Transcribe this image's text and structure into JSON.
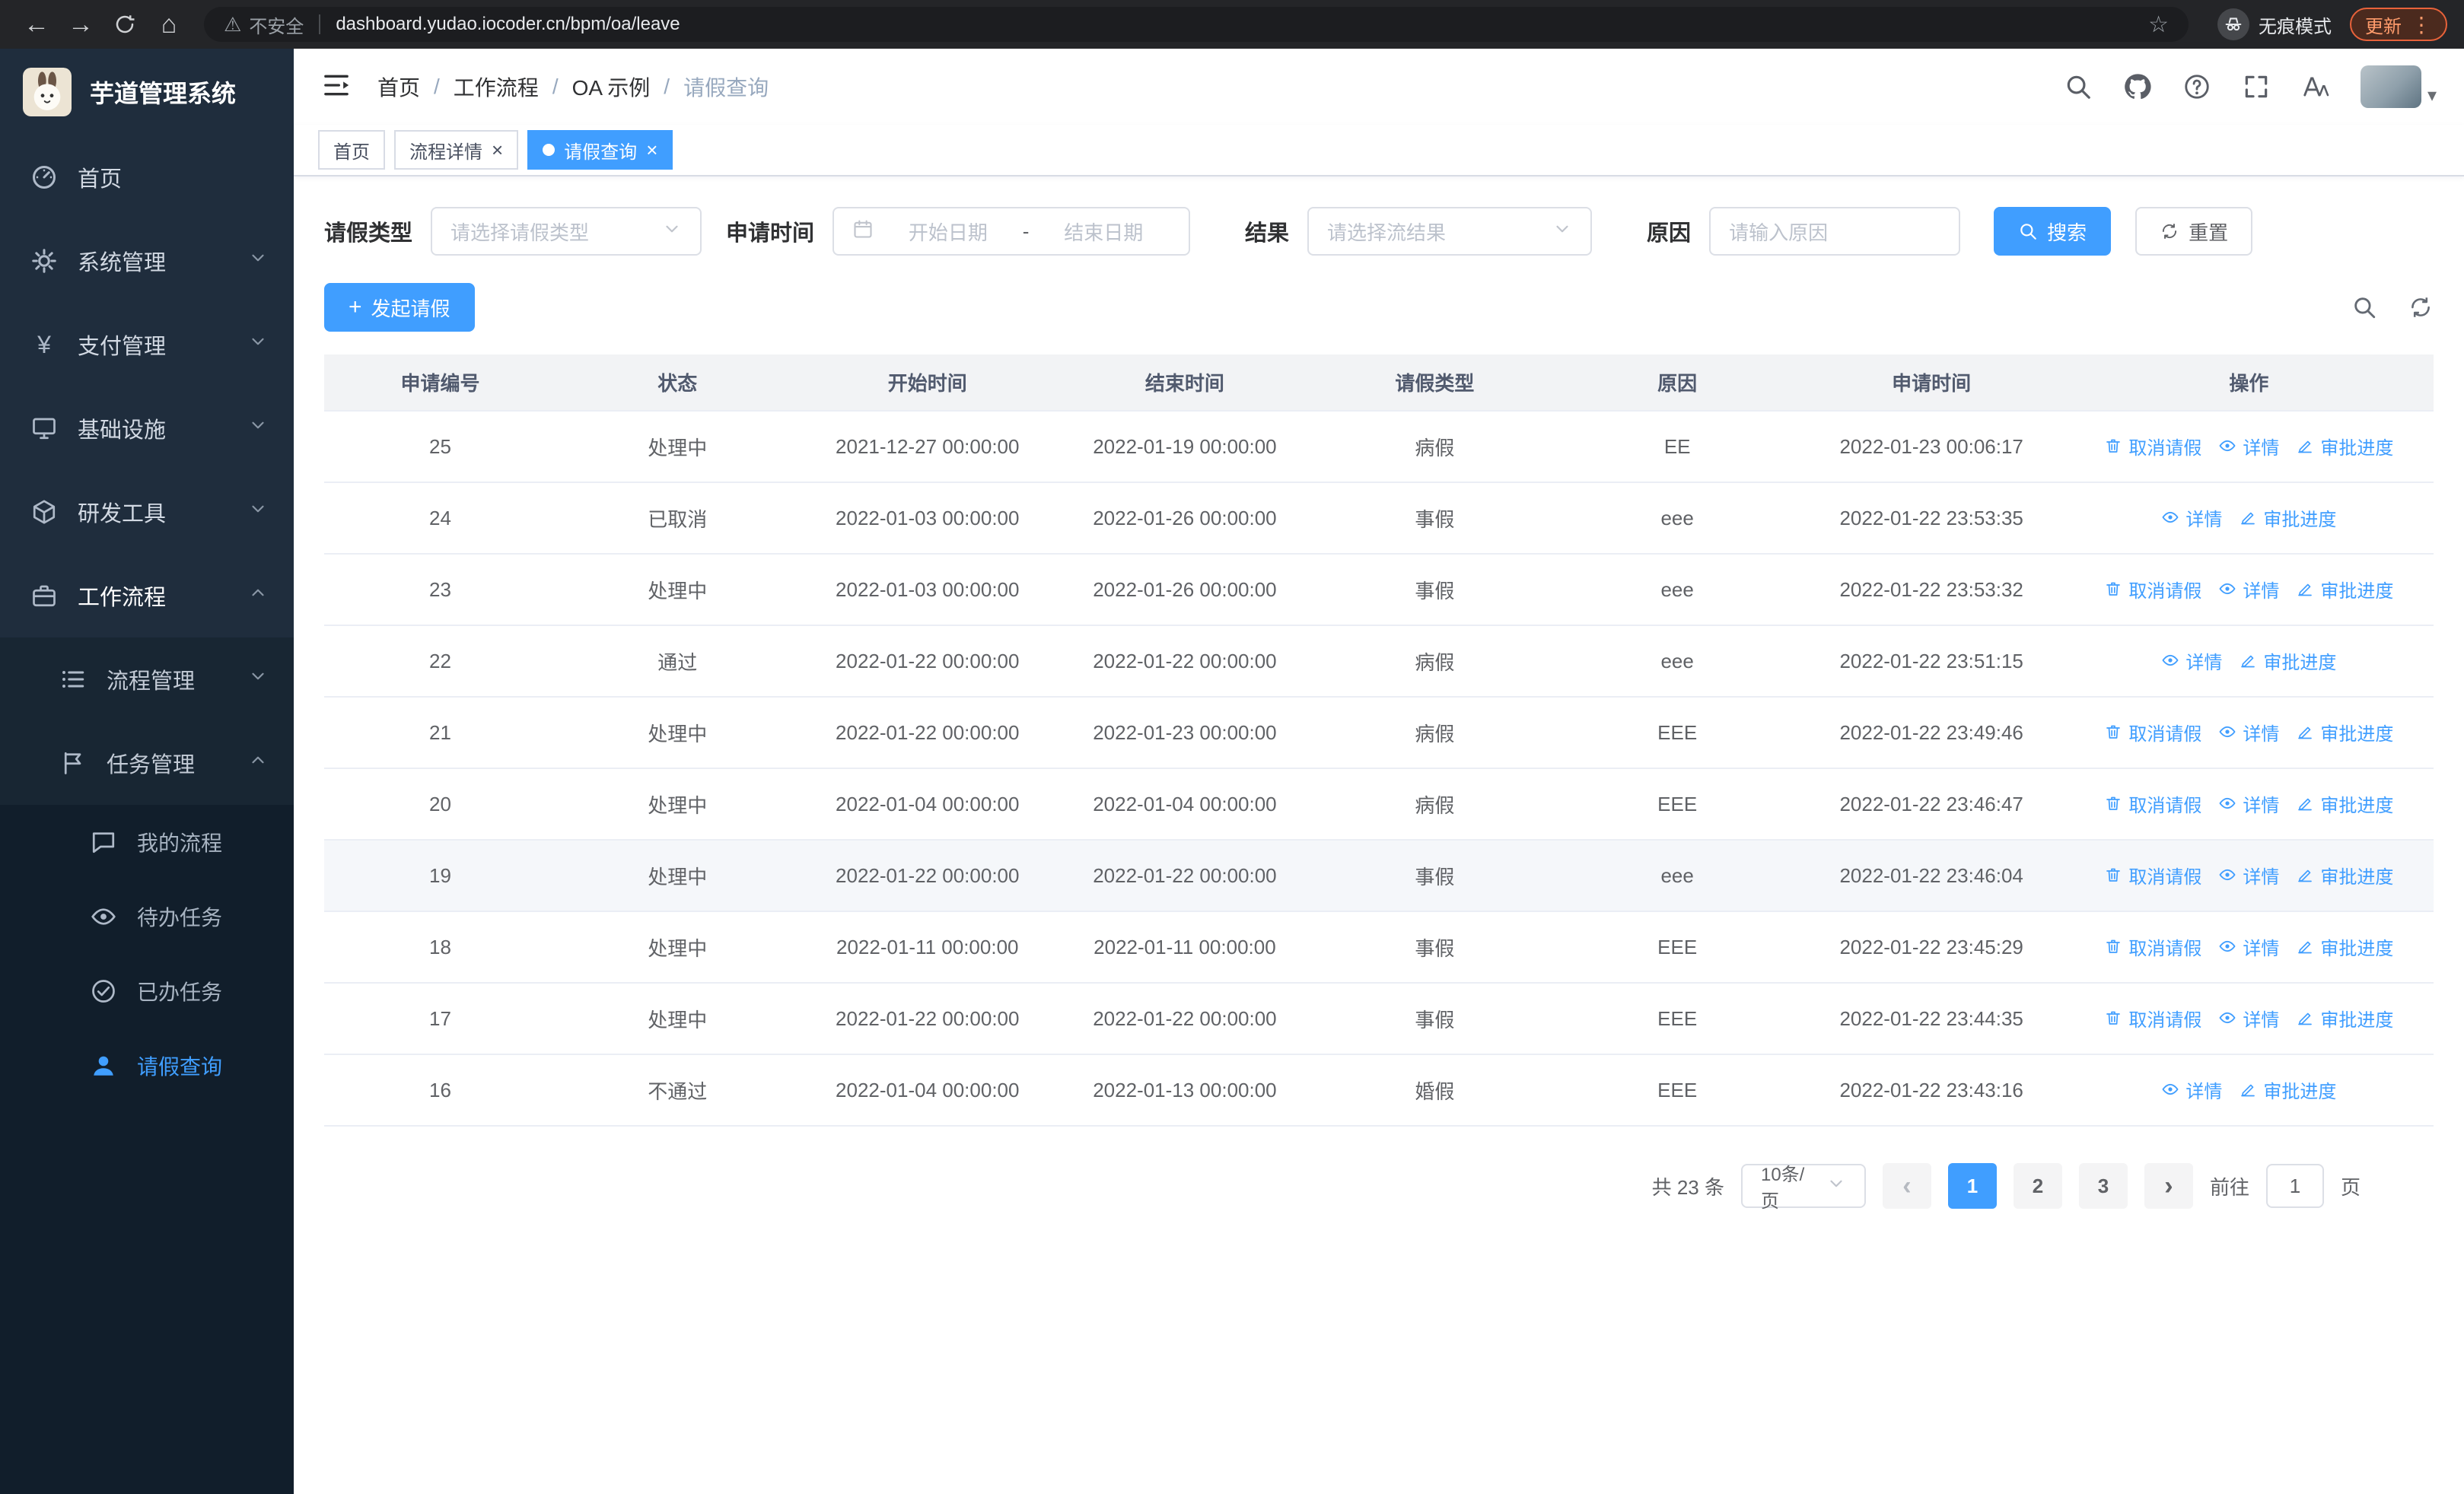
{
  "browser": {
    "security_label": "不安全",
    "url": "dashboard.yudao.iocoder.cn/bpm/oa/leave",
    "incognito_label": "无痕模式",
    "update_label": "更新"
  },
  "icons": {
    "back": "←",
    "forward": "→",
    "home": "⌂",
    "warning": "⚠",
    "star": "☆",
    "kebab": "⋮",
    "caret": "▾",
    "prev": "‹",
    "next": "›",
    "close": "×",
    "plus": "+",
    "yen": "¥"
  },
  "sidebar": {
    "logo_title": "芋道管理系统",
    "items": [
      {
        "label": "首页"
      },
      {
        "label": "系统管理"
      },
      {
        "label": "支付管理"
      },
      {
        "label": "基础设施"
      },
      {
        "label": "研发工具"
      },
      {
        "label": "工作流程"
      }
    ],
    "submenu": [
      {
        "label": "流程管理"
      },
      {
        "label": "任务管理"
      }
    ],
    "deep_items": [
      {
        "label": "我的流程"
      },
      {
        "label": "待办任务"
      },
      {
        "label": "已办任务"
      },
      {
        "label": "请假查询"
      }
    ]
  },
  "header": {
    "separator": "/",
    "breadcrumbs": [
      "首页",
      "工作流程",
      "OA 示例",
      "请假查询"
    ]
  },
  "tabs": [
    {
      "label": "首页"
    },
    {
      "label": "流程详情"
    },
    {
      "label": "请假查询"
    }
  ],
  "filters": {
    "leave_type_label": "请假类型",
    "leave_type_placeholder": "请选择请假类型",
    "apply_time_label": "申请时间",
    "start_date_placeholder": "开始日期",
    "range_separator": "-",
    "end_date_placeholder": "结束日期",
    "result_label": "结果",
    "result_placeholder": "请选择流结果",
    "reason_label": "原因",
    "reason_placeholder": "请输入原因",
    "search_button": "搜索",
    "reset_button": "重置"
  },
  "toolbar": {
    "create_button": "发起请假"
  },
  "table": {
    "columns": [
      "申请编号",
      "状态",
      "开始时间",
      "结束时间",
      "请假类型",
      "原因",
      "申请时间",
      "操作"
    ],
    "actions": {
      "cancel": "取消请假",
      "detail": "详情",
      "progress": "审批进度"
    },
    "rows": [
      {
        "id": "25",
        "status": "处理中",
        "start": "2021-12-27 00:00:00",
        "end": "2022-01-19 00:00:00",
        "type": "病假",
        "reason": "EE",
        "applied": "2022-01-23 00:06:17",
        "cancelable": true,
        "hover": false
      },
      {
        "id": "24",
        "status": "已取消",
        "start": "2022-01-03 00:00:00",
        "end": "2022-01-26 00:00:00",
        "type": "事假",
        "reason": "eee",
        "applied": "2022-01-22 23:53:35",
        "cancelable": false,
        "hover": false
      },
      {
        "id": "23",
        "status": "处理中",
        "start": "2022-01-03 00:00:00",
        "end": "2022-01-26 00:00:00",
        "type": "事假",
        "reason": "eee",
        "applied": "2022-01-22 23:53:32",
        "cancelable": true,
        "hover": false
      },
      {
        "id": "22",
        "status": "通过",
        "start": "2022-01-22 00:00:00",
        "end": "2022-01-22 00:00:00",
        "type": "病假",
        "reason": "eee",
        "applied": "2022-01-22 23:51:15",
        "cancelable": false,
        "hover": false
      },
      {
        "id": "21",
        "status": "处理中",
        "start": "2022-01-22 00:00:00",
        "end": "2022-01-23 00:00:00",
        "type": "病假",
        "reason": "EEE",
        "applied": "2022-01-22 23:49:46",
        "cancelable": true,
        "hover": false
      },
      {
        "id": "20",
        "status": "处理中",
        "start": "2022-01-04 00:00:00",
        "end": "2022-01-04 00:00:00",
        "type": "病假",
        "reason": "EEE",
        "applied": "2022-01-22 23:46:47",
        "cancelable": true,
        "hover": false
      },
      {
        "id": "19",
        "status": "处理中",
        "start": "2022-01-22 00:00:00",
        "end": "2022-01-22 00:00:00",
        "type": "事假",
        "reason": "eee",
        "applied": "2022-01-22 23:46:04",
        "cancelable": true,
        "hover": true
      },
      {
        "id": "18",
        "status": "处理中",
        "start": "2022-01-11 00:00:00",
        "end": "2022-01-11 00:00:00",
        "type": "事假",
        "reason": "EEE",
        "applied": "2022-01-22 23:45:29",
        "cancelable": true,
        "hover": false
      },
      {
        "id": "17",
        "status": "处理中",
        "start": "2022-01-22 00:00:00",
        "end": "2022-01-22 00:00:00",
        "type": "事假",
        "reason": "EEE",
        "applied": "2022-01-22 23:44:35",
        "cancelable": true,
        "hover": false
      },
      {
        "id": "16",
        "status": "不通过",
        "start": "2022-01-04 00:00:00",
        "end": "2022-01-13 00:00:00",
        "type": "婚假",
        "reason": "EEE",
        "applied": "2022-01-22 23:43:16",
        "cancelable": false,
        "hover": false
      }
    ]
  },
  "pagination": {
    "total_label": "共 23 条",
    "page_size": "10条/页",
    "pages": [
      "1",
      "2",
      "3"
    ],
    "active_page": "1",
    "goto_label": "前往",
    "goto_value": "1",
    "page_unit": "页"
  },
  "colors": {
    "primary": "#409eff",
    "sidebar_bg": "#1f2d3d",
    "header_bg": "#f2f3f5"
  }
}
